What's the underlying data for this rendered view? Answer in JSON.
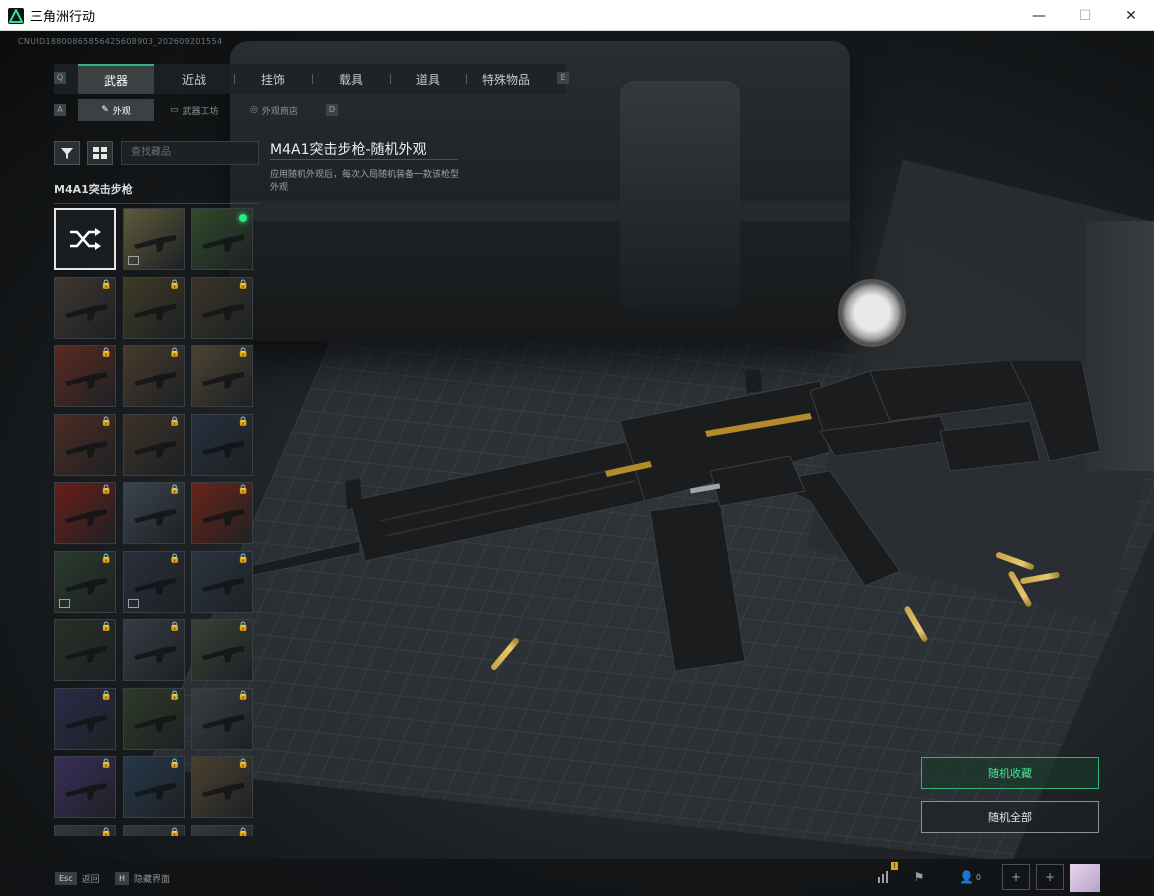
{
  "window": {
    "title": "三角洲行动",
    "minimize": "—",
    "maximize": "☐",
    "close": "✕"
  },
  "uid_text": "CNUID1880086585642560890​3_202609201554",
  "nav": {
    "left_key": "Q",
    "right_key": "E",
    "tabs": [
      "武器",
      "近战",
      "挂饰",
      "载具",
      "道具",
      "特殊物品"
    ],
    "active_index": 0
  },
  "subnav": {
    "left_key": "A",
    "right_key": "D",
    "tabs": [
      "外观",
      "武器工坊",
      "外观商店"
    ],
    "active_index": 0
  },
  "search": {
    "placeholder": "查找藏品"
  },
  "category": {
    "title": "M4A1突击步枪"
  },
  "grid": {
    "items": [
      {
        "type": "random",
        "locked": false
      },
      {
        "color": "#5d5a3a",
        "locked": false,
        "badge": true
      },
      {
        "color": "#2f4a2a",
        "locked": false,
        "equipped": true
      },
      {
        "color": "#3e3630",
        "locked": true
      },
      {
        "color": "#3d3a24",
        "locked": true
      },
      {
        "color": "#3a3428",
        "locked": true
      },
      {
        "color": "#5a2a22",
        "locked": true
      },
      {
        "color": "#473a2c",
        "locked": true
      },
      {
        "color": "#4b4232",
        "locked": true
      },
      {
        "color": "#4d2c22",
        "locked": true
      },
      {
        "color": "#3d3227",
        "locked": true
      },
      {
        "color": "#24303d",
        "locked": true
      },
      {
        "color": "#6a1e18",
        "locked": true
      },
      {
        "color": "#3b4550",
        "locked": true
      },
      {
        "color": "#6a2418",
        "locked": true
      },
      {
        "color": "#2a3a2c",
        "locked": true,
        "badge": true
      },
      {
        "color": "#2a2e3c",
        "locked": true,
        "badge": true
      },
      {
        "color": "#2a3440",
        "locked": true
      },
      {
        "color": "#263026",
        "locked": true
      },
      {
        "color": "#353c44",
        "locked": true
      },
      {
        "color": "#3a4036",
        "locked": true
      },
      {
        "color": "#2b2a4a",
        "locked": true
      },
      {
        "color": "#2e3a28",
        "locked": true
      },
      {
        "color": "#3a3e42",
        "locked": true
      },
      {
        "color": "#3a2e5a",
        "locked": true
      },
      {
        "color": "#24384a",
        "locked": true
      },
      {
        "color": "#4a4030",
        "locked": true
      },
      {
        "color": "#34383c",
        "locked": true
      },
      {
        "color": "#34383c",
        "locked": true
      },
      {
        "color": "#34383c",
        "locked": true
      }
    ],
    "lock_glyph": "🔒"
  },
  "detail": {
    "title": "M4A1突击步枪-随机外观",
    "description": "应用随机外观后，每次入局随机装备一款该枪型外观"
  },
  "actions": {
    "random_favorite": "随机收藏",
    "random_all": "随机全部"
  },
  "bottom": {
    "back_key": "Esc",
    "back_label": "返回",
    "hide_key": "H",
    "hide_label": "隐藏界面",
    "stats_badge": "!",
    "friends_count": "0",
    "add1": "+",
    "add2": "+"
  },
  "colors": {
    "accent": "#2fb27c",
    "equipped_dot": "#2ee58a"
  }
}
